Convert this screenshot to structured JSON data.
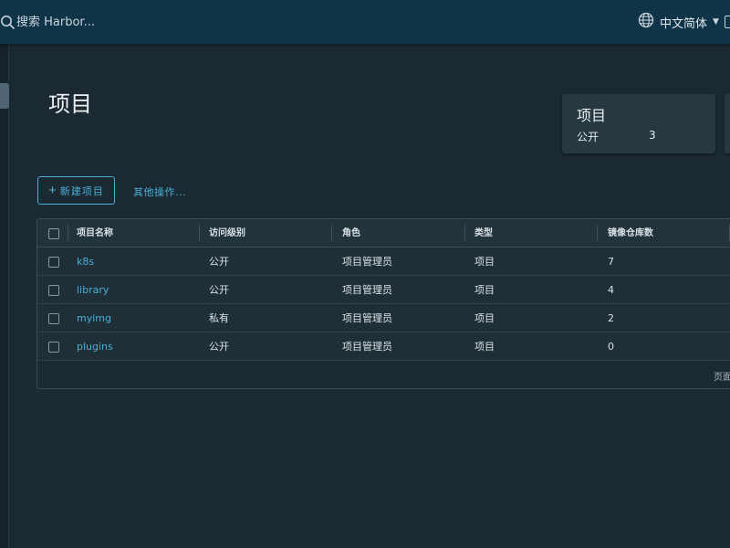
{
  "header": {
    "search_placeholder": "搜索 Harbor...",
    "language_label": "中文简体"
  },
  "page": {
    "title": "项目"
  },
  "summary": {
    "title": "项目",
    "public_label": "公开",
    "public_count": "3"
  },
  "toolbar": {
    "new_project_label": "新建项目",
    "new_project_icon": "plus-icon",
    "other_actions_label": "其他操作..."
  },
  "table": {
    "columns": [
      "项目名称",
      "访问级别",
      "角色",
      "类型",
      "镜像仓库数"
    ],
    "rows": [
      {
        "name": "k8s",
        "access": "公开",
        "role": "项目管理员",
        "type": "项目",
        "repos": "7"
      },
      {
        "name": "library",
        "access": "公开",
        "role": "项目管理员",
        "type": "项目",
        "repos": "4"
      },
      {
        "name": "myimg",
        "access": "私有",
        "role": "项目管理员",
        "type": "项目",
        "repos": "2"
      },
      {
        "name": "plugins",
        "access": "公开",
        "role": "项目管理员",
        "type": "项目",
        "repos": "0"
      }
    ],
    "footer_text": "页面"
  },
  "colors": {
    "accent": "#4aaed9",
    "header_bg": "#0f3347",
    "page_bg": "#1b2a32"
  }
}
